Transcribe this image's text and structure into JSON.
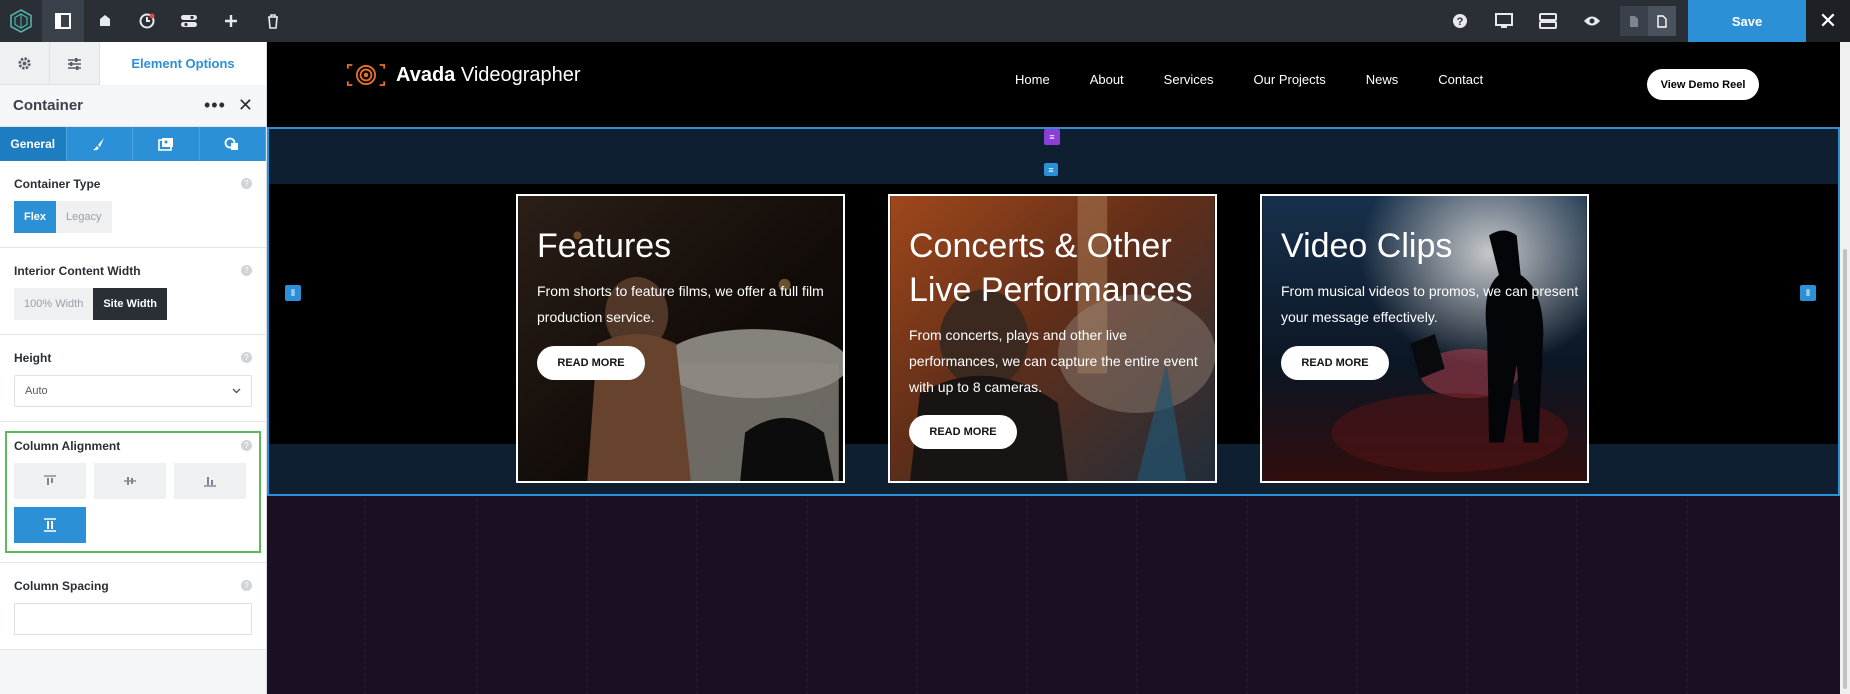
{
  "toolbar": {
    "save_label": "Save"
  },
  "sidebar": {
    "tab_element_options": "Element Options",
    "panel_title": "Container",
    "tabs": [
      "General"
    ],
    "container_type": {
      "label": "Container Type",
      "options": [
        "Flex",
        "Legacy"
      ],
      "selected": "Flex"
    },
    "interior_width": {
      "label": "Interior Content Width",
      "options": [
        "100% Width",
        "Site Width"
      ],
      "selected": "Site Width"
    },
    "height": {
      "label": "Height",
      "value": "Auto"
    },
    "column_alignment": {
      "label": "Column Alignment"
    },
    "column_spacing": {
      "label": "Column Spacing"
    }
  },
  "site": {
    "brand_bold": "Avada",
    "brand_rest": "Videographer",
    "nav": [
      "Home",
      "About",
      "Services",
      "Our Projects",
      "News",
      "Contact"
    ],
    "cta": "View Demo Reel",
    "cards": [
      {
        "title": "Features",
        "text": "From shorts to feature films, we offer a full film production service.",
        "button": "READ MORE"
      },
      {
        "title": "Concerts & Other Live Performances",
        "text": "From concerts, plays and other live performances, we can capture the entire event with up to 8 cameras.",
        "button": "READ MORE"
      },
      {
        "title": "Video Clips",
        "text": "From musical videos to promos, we can present your message effectively.",
        "button": "READ MORE"
      }
    ]
  },
  "colors": {
    "accent": "#2c90d7",
    "toolbar_bg": "#2a2f36",
    "highlight_border": "#5cb85c",
    "brand_orange": "#e8702a"
  }
}
